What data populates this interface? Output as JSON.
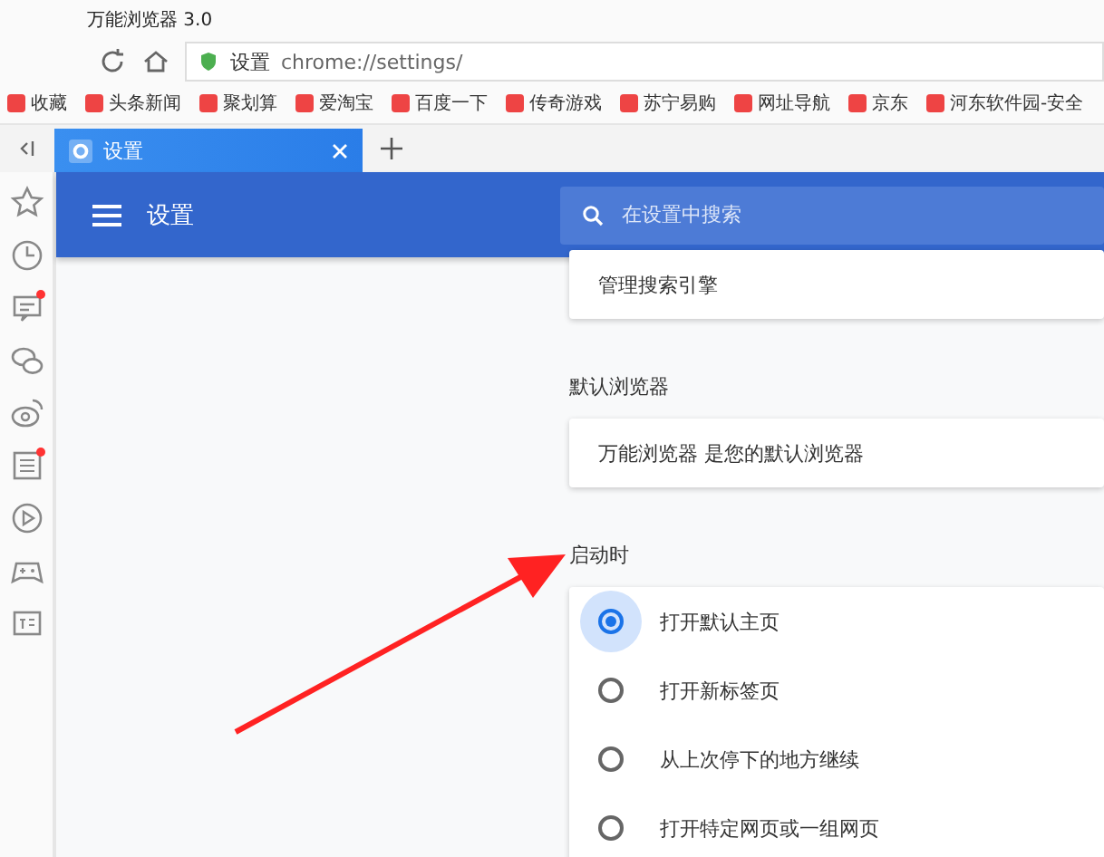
{
  "window": {
    "title": "万能浏览器 3.0"
  },
  "address_bar": {
    "page_label": "设置",
    "url": "chrome://settings/"
  },
  "bookmarks": [
    "收藏",
    "头条新闻",
    "聚划算",
    "爱淘宝",
    "百度一下",
    "传奇游戏",
    "苏宁易购",
    "网址导航",
    "京东",
    "河东软件园-安全"
  ],
  "tabs": [
    {
      "label": "设置",
      "selected": true
    }
  ],
  "sidebar": {
    "items": [
      {
        "kind": "star",
        "badge": false
      },
      {
        "kind": "clock",
        "badge": false
      },
      {
        "kind": "news",
        "badge": true
      },
      {
        "kind": "chat",
        "badge": false
      },
      {
        "kind": "weibo",
        "badge": false
      },
      {
        "kind": "taobao",
        "badge": true
      },
      {
        "kind": "play",
        "badge": false
      },
      {
        "kind": "game",
        "badge": false
      },
      {
        "kind": "reader",
        "badge": false
      }
    ]
  },
  "settings": {
    "title": "设置",
    "search": {
      "placeholder": "在设置中搜索"
    },
    "sections": [
      {
        "rows": [
          {
            "kind": "text",
            "label": "管理搜索引擎"
          }
        ]
      },
      {
        "heading": "默认浏览器",
        "rows": [
          {
            "kind": "text",
            "label": "万能浏览器 是您的默认浏览器"
          }
        ]
      },
      {
        "heading": "启动时",
        "rows": [
          {
            "kind": "radio",
            "label": "打开默认主页",
            "selected": true
          },
          {
            "kind": "radio",
            "label": "打开新标签页",
            "selected": false
          },
          {
            "kind": "radio",
            "label": "从上次停下的地方继续",
            "selected": false
          },
          {
            "kind": "radio",
            "label": "打开特定网页或一组网页",
            "selected": false
          }
        ]
      }
    ]
  }
}
